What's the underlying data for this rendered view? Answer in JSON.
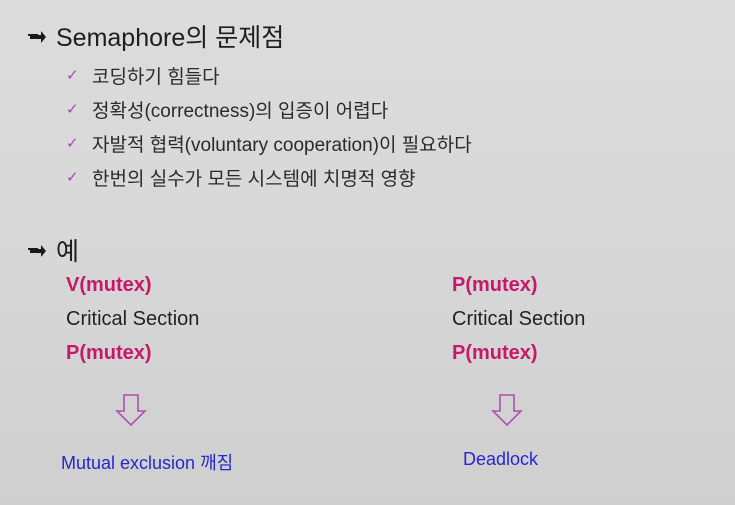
{
  "slide": {
    "heading_1": "Semaphore의 문제점",
    "problems": [
      "코딩하기 힘들다",
      "정확성(correctness)의 입증이 어렵다",
      "자발적 협력(voluntary cooperation)이 필요하다",
      "한번의 실수가 모든 시스템에 치명적 영향"
    ],
    "heading_2": "예",
    "example_left": {
      "line1": "V(mutex)",
      "line2": "Critical Section",
      "line3": "P(mutex)",
      "result": "Mutual exclusion 깨짐"
    },
    "example_right": {
      "line1": "P(mutex)",
      "line2": "Critical Section",
      "line3": "P(mutex)",
      "result": "Deadlock"
    }
  },
  "colors": {
    "operation": "#c8186a",
    "result": "#2626d0",
    "check": "#b040c0"
  },
  "icons": {
    "heading_bullet": "arrow-bullet-icon",
    "list_bullet": "check-icon",
    "result_arrow": "hollow-down-arrow-icon"
  }
}
